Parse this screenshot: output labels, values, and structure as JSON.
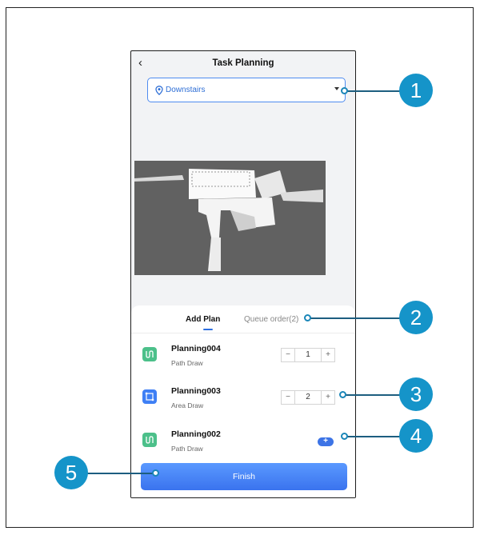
{
  "header": {
    "title": "Task Planning",
    "back_icon": "chevron-left-icon"
  },
  "floor_select": {
    "value": "Downstairs",
    "icon": "location-pin-icon"
  },
  "tabs": [
    {
      "label": "Add Plan",
      "active": true
    },
    {
      "label": "Queue order(2)",
      "active": false
    }
  ],
  "plans": [
    {
      "name": "Planning004",
      "type": "Path Draw",
      "quantity": "1",
      "icon": "path-draw-icon",
      "color": "#4cc08a"
    },
    {
      "name": "Planning003",
      "type": "Area Draw",
      "quantity": "2",
      "icon": "area-draw-icon",
      "color": "#3e7ff5"
    },
    {
      "name": "Planning002",
      "type": "Path Draw",
      "add_label": "+",
      "icon": "path-draw-icon",
      "color": "#4cc08a"
    }
  ],
  "stepper": {
    "minus": "−",
    "plus": "+"
  },
  "finish_label": "Finish",
  "callouts": [
    "1",
    "2",
    "3",
    "4",
    "5"
  ],
  "colors": {
    "accent": "#3d74e6",
    "callout": "#1594c9",
    "map": "#616161"
  }
}
